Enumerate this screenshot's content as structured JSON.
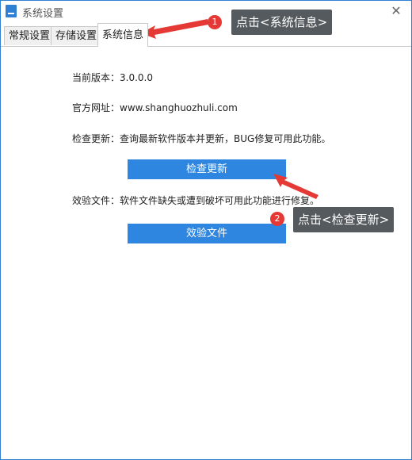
{
  "window": {
    "title": "系统设置",
    "close_glyph": "✕"
  },
  "tabs": [
    {
      "label": "常规设置"
    },
    {
      "label": "存储设置"
    },
    {
      "label": "系统信息",
      "active": true
    }
  ],
  "info": {
    "version": "当前版本：3.0.0.0",
    "website": "官方网址：www.shanghuozhuli.com",
    "update_desc": "检查更新：查询最新软件版本并更新，BUG修复可用此功能。",
    "update_button": "检查更新",
    "verify_desc": "效验文件：软件文件缺失或遭到破坏可用此功能进行修复。",
    "verify_button": "效验文件"
  },
  "annotations": [
    {
      "number": "1",
      "text": "点击<系统信息>"
    },
    {
      "number": "2",
      "text": "点击<检查更新>"
    }
  ],
  "colors": {
    "accent": "#2f86e0",
    "callout": "#555a5e",
    "badge": "#e53935",
    "arrow": "#e53935"
  }
}
